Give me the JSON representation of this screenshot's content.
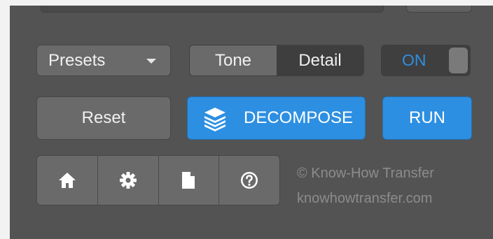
{
  "presets": {
    "label": "Presets"
  },
  "mode": {
    "tone": "Tone",
    "detail": "Detail",
    "selected": "Detail"
  },
  "toggle": {
    "label": "ON",
    "state": "on"
  },
  "actions": {
    "reset": "Reset",
    "decompose": "DECOMPOSE",
    "run": "RUN"
  },
  "toolbar": {
    "icons": [
      "home-icon",
      "gear-icon",
      "document-icon",
      "help-icon"
    ]
  },
  "footer": {
    "copyright": "© Know-How Transfer",
    "website": "knowhowtransfer.com"
  },
  "colors": {
    "accent": "#2d8fe2",
    "panel": "#535353",
    "button": "#6a6a6a"
  }
}
